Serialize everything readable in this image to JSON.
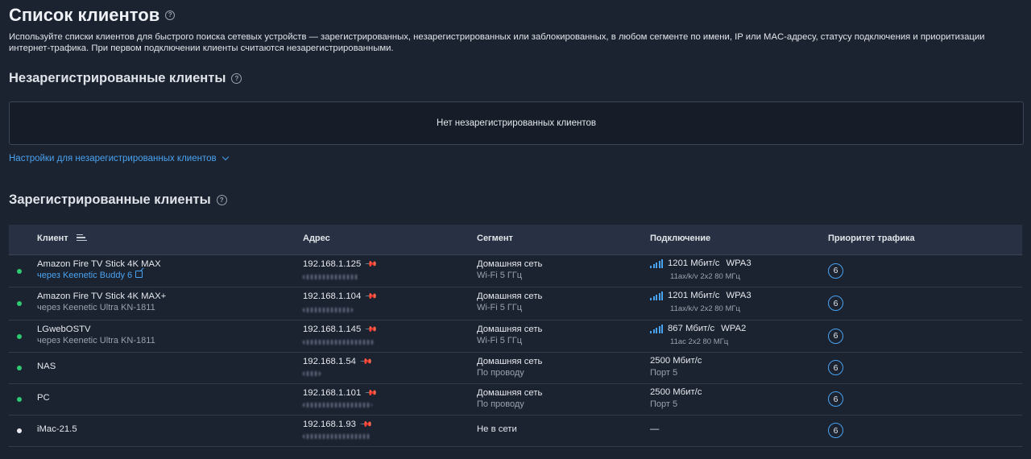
{
  "page": {
    "title": "Список клиентов",
    "description": "Используйте списки клиентов для быстрого поиска сетевых устройств — зарегистрированных, незарегистрированных или заблокированных, в любом сегменте по имени, IP или MAC-адресу, статусу подключения и приоритизации интернет-трафика. При первом подключении клиенты считаются незарегистрированными."
  },
  "unregistered": {
    "title": "Незарегистрированные клиенты",
    "empty_text": "Нет незарегистрированных клиентов",
    "settings_link": "Настройки для незарегистрированных клиентов"
  },
  "registered": {
    "title": "Зарегистрированные клиенты",
    "columns": {
      "client": "Клиент",
      "address": "Адрес",
      "segment": "Сегмент",
      "connection": "Подключение",
      "priority": "Приоритет трафика"
    },
    "rows": [
      {
        "name": "Amazon Fire TV Stick 4K MAX",
        "via": "через Keenetic Buddy 6",
        "via_link": true,
        "ip": "192.168.1.125",
        "segment": "Домашняя сеть",
        "segment_sub": "Wi-Fi 5 ГГц",
        "speed": "1201 Мбит/с",
        "security": "WPA3",
        "conn_sub": "11ax/k/v 2x2 80 МГц",
        "wifi": true,
        "priority": "6",
        "status_color": "#2ecc71"
      },
      {
        "name": "Amazon Fire TV Stick 4K MAX+",
        "via": "через Keenetic Ultra KN-1811",
        "via_link": false,
        "ip": "192.168.1.104",
        "segment": "Домашняя сеть",
        "segment_sub": "Wi-Fi 5 ГГц",
        "speed": "1201 Мбит/с",
        "security": "WPA3",
        "conn_sub": "11ax/k/v 2x2 80 МГц",
        "wifi": true,
        "priority": "6",
        "status_color": "#2ecc71"
      },
      {
        "name": "LGwebOSTV",
        "via": "через Keenetic Ultra KN-1811",
        "via_link": false,
        "ip": "192.168.1.145",
        "segment": "Домашняя сеть",
        "segment_sub": "Wi-Fi 5 ГГц",
        "speed": "867 Мбит/с",
        "security": "WPA2",
        "conn_sub": "11ac 2x2 80 МГц",
        "wifi": true,
        "priority": "6",
        "status_color": "#2ecc71"
      },
      {
        "name": "NAS",
        "via": "",
        "via_link": false,
        "ip": "192.168.1.54",
        "segment": "Домашняя сеть",
        "segment_sub": "По проводу",
        "speed": "2500 Мбит/с",
        "security": "",
        "conn_sub": "Порт 5",
        "wifi": false,
        "priority": "6",
        "status_color": "#2ecc71"
      },
      {
        "name": "PC",
        "via": "",
        "via_link": false,
        "ip": "192.168.1.101",
        "segment": "Домашняя сеть",
        "segment_sub": "По проводу",
        "speed": "2500 Мбит/с",
        "security": "",
        "conn_sub": "Порт 5",
        "wifi": false,
        "priority": "6",
        "status_color": "#2ecc71"
      },
      {
        "name": "iMac-21.5",
        "via": "",
        "via_link": false,
        "ip": "192.168.1.93",
        "segment": "Не в сети",
        "segment_sub": "",
        "speed": "—",
        "security": "",
        "conn_sub": "",
        "wifi": false,
        "priority": "6",
        "status_color": "#e8eaee"
      }
    ]
  }
}
